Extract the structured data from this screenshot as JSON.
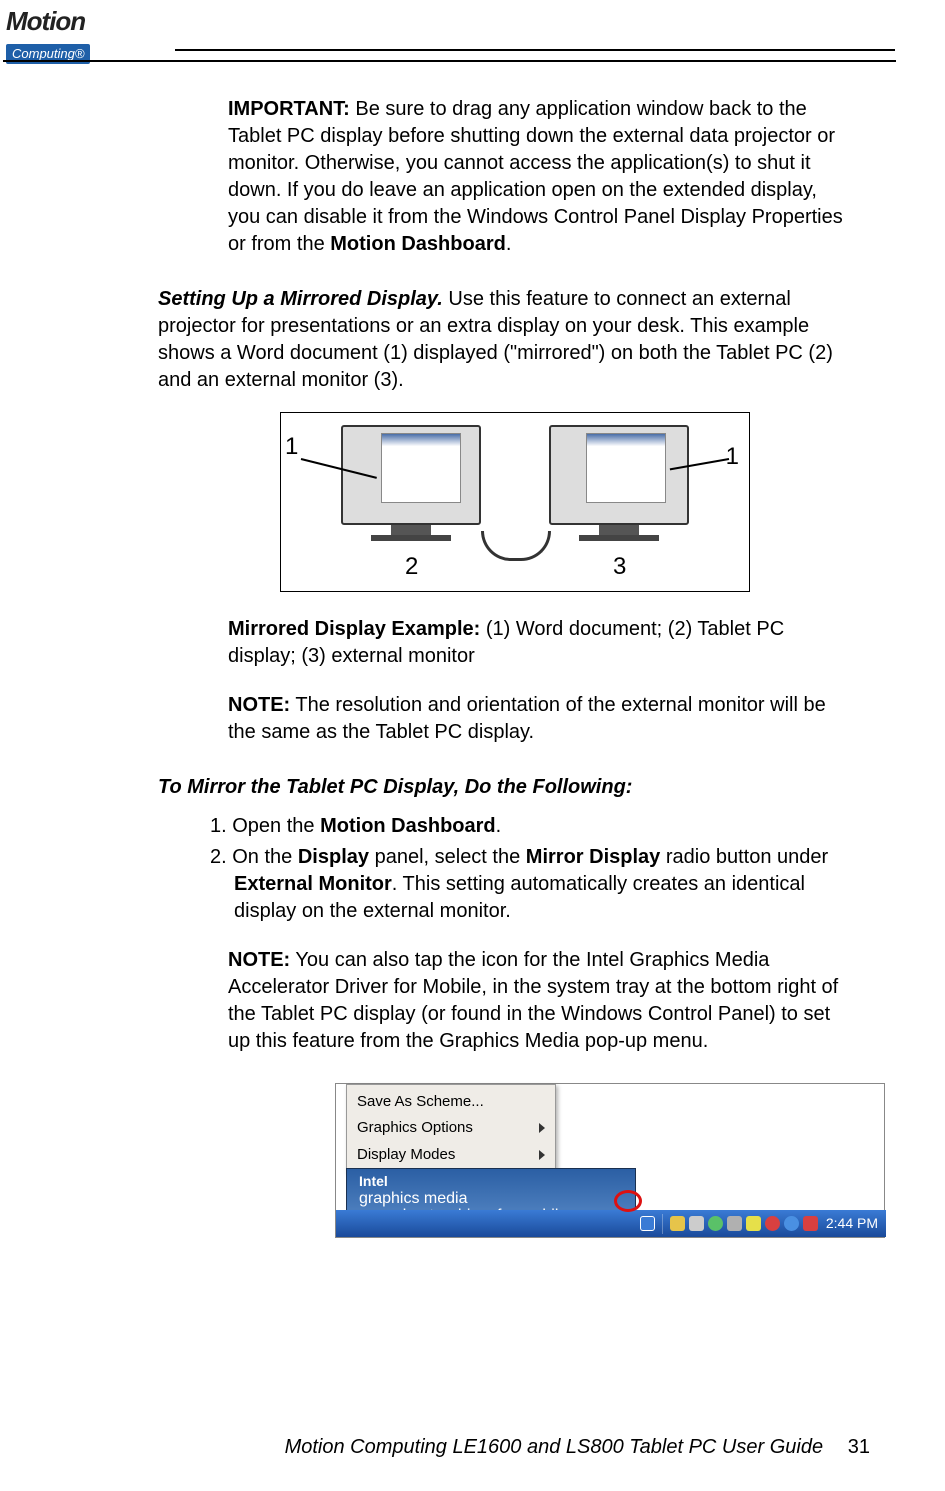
{
  "logo": {
    "name": "Motion",
    "sub": "Computing®"
  },
  "p_important": {
    "label": "IMPORTANT:",
    "text": " Be sure to drag any application window back to the Tablet PC display before shutting down the external data projector or monitor. Otherwise, you cannot access the application(s) to shut it down. If you do leave an application open on the extended display, you can disable it from the Windows Control Panel Display Properties or from the ",
    "bold_end": "Motion Dashboard",
    "dot": "."
  },
  "p_mirror_intro": {
    "heading": "Setting Up a Mirrored Display.",
    "text": " Use this feature to connect an external projector for presentations or an extra display on your desk. This example shows a Word document (1) displayed (\"mirrored\") on both the Tablet PC (2) and an external monitor (3)."
  },
  "fig1": {
    "l1": "1",
    "l2": "2",
    "l3": "3",
    "l1b": "1"
  },
  "p_example": {
    "label": "Mirrored Display Example:",
    "text": " (1) Word document; (2) Tablet PC display; (3) external monitor"
  },
  "p_note1": {
    "label": "NOTE:",
    "text": " The resolution and orientation of the external monitor will be the same as the Tablet PC display."
  },
  "p_steps_heading": "To Mirror the Tablet PC Display, Do the Following:",
  "step1": {
    "num": "1. ",
    "a": "Open the ",
    "b": "Motion Dashboard",
    "c": "."
  },
  "step2": {
    "num": "2. ",
    "a": "On the ",
    "b": "Display",
    "c": " panel, select the ",
    "d": "Mirror Display",
    "e": " radio button under ",
    "f": "External Monitor",
    "g": ". This setting automatically creates an identical display on the external monitor."
  },
  "p_note2": {
    "label": "NOTE:",
    "text": " You can also tap the icon for the Intel Graphics Media Accelerator Driver for Mobile, in the system tray at the bottom right of the Tablet PC display (or found in the Windows Control Panel) to set up this feature from the Graphics Media pop-up menu."
  },
  "menu": {
    "i1": "Save As Scheme...",
    "i2": "Graphics Options",
    "i3": "Display Modes"
  },
  "tooltip": {
    "intel": "Intel",
    "line": "graphics media",
    "line2": "accelerator driver for mobile"
  },
  "clock": "2:44 PM",
  "footer": {
    "title": "Motion Computing LE1600 and LS800 Tablet PC User Guide",
    "page": "31"
  }
}
